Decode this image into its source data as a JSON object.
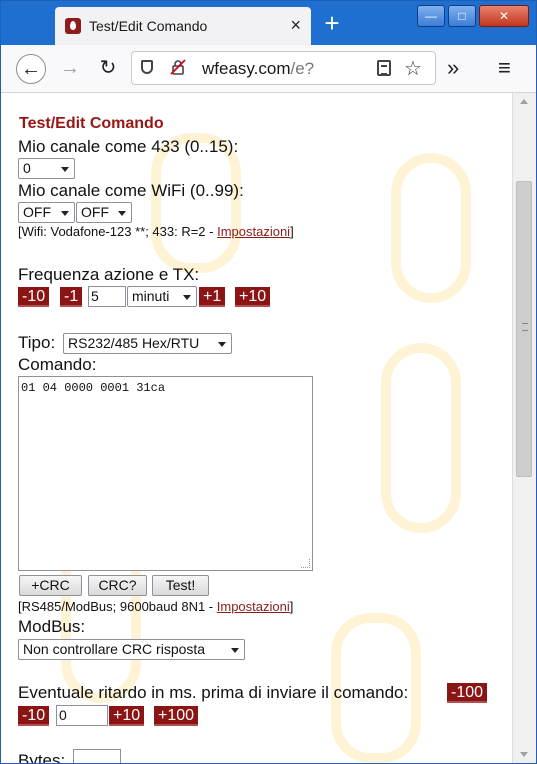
{
  "browser": {
    "tab_title": "Test/Edit Comando",
    "tab_close": "×",
    "new_tab": "+",
    "url_host": "wfeasy.com",
    "url_path": "/e?",
    "controls": {
      "minimize": "—",
      "maximize": "□",
      "close": "✕"
    },
    "icons": [
      "back-icon",
      "forward-icon",
      "reload-icon",
      "shield-icon",
      "insecure-lock-icon",
      "reader-icon",
      "overflow-icon",
      "menu-icon"
    ]
  },
  "page": {
    "title": "Test/Edit Comando",
    "channel433_label": "Mio canale come 433 (0..15):",
    "channel433_value": "0",
    "wifi_channel_label": "Mio canale come WiFi (0..99):",
    "wifi_sel1": "OFF",
    "wifi_sel2": "OFF",
    "wifi_info_prefix": "[Wifi: Vodafone-123 **; 433: R=2 - ",
    "wifi_info_link": "Impostazioni",
    "wifi_info_suffix": "]",
    "freq_label": "Frequenza azione e TX:",
    "freq_minus10": "-10",
    "freq_minus1": "-1",
    "freq_value": "5",
    "freq_unit": "minuti",
    "freq_plus1": "+1",
    "freq_plus10": "+10",
    "tipo_label": "Tipo:",
    "tipo_value": "RS232/485 Hex/RTU",
    "comando_label": "Comando:",
    "comando_value": "01 04 0000 0001 31ca",
    "btn_add_crc": "+CRC",
    "btn_crc_check": "CRC?",
    "btn_test": "Test!",
    "rs485_info_prefix": "[RS485/ModBus; 9600baud 8N1 - ",
    "rs485_info_link": "Impostazioni",
    "rs485_info_suffix": "]",
    "modbus_label": "ModBus:",
    "modbus_value": "Non controllare CRC risposta",
    "delay_label": "Eventuale ritardo in ms. prima di inviare il comando:",
    "delay_minus100": "-100",
    "delay_minus10": "-10",
    "delay_value": "0",
    "delay_plus10": "+10",
    "delay_plus100": "+100",
    "bytes_label_partial": "Bytes:"
  },
  "colors": {
    "titlebar": "#1f6fd0",
    "accent_red": "#8b1515",
    "heading_red": "#9a1515",
    "watermark": "#fff3d6"
  }
}
